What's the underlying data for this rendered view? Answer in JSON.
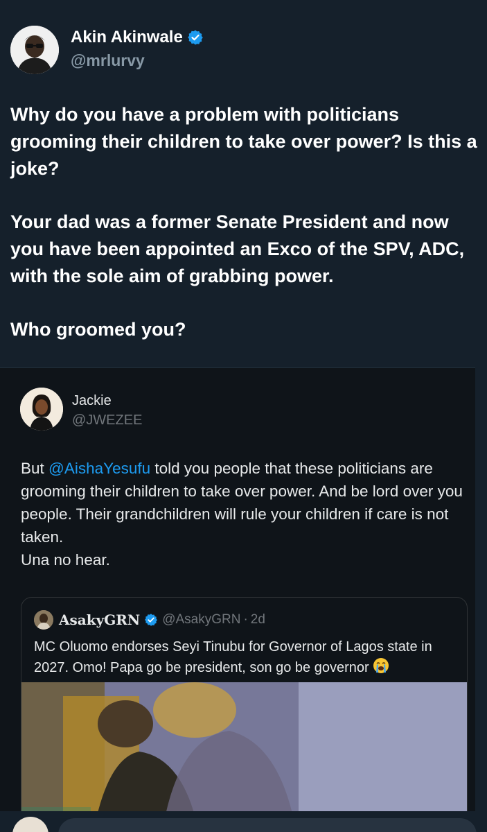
{
  "main_tweet": {
    "author_name": "Akin Akinwale",
    "author_handle": "@mrlurvy",
    "verified": true,
    "paragraphs": [
      "Why do you have a problem with politicians grooming their children to take over power? Is this a joke?",
      "Your dad was a former Senate President and now you have been appointed an Exco of the SPV, ADC, with the sole aim of grabbing power.",
      "Who groomed you?"
    ]
  },
  "quoted_tweet": {
    "author_name": "Jackie",
    "author_handle": "@JWEZEE",
    "text_before_mention": "But ",
    "mention": "@AishaYesufu",
    "text_after_mention": " told you people that these politicians are grooming their children to take over power. And be lord over you people. Their grandchildren will rule your children if care is not taken.",
    "text_line_last": "Una no hear."
  },
  "nested_quote": {
    "author_name": "AsakyGRN",
    "author_handle": "@AsakyGRN",
    "separator": "·",
    "time": "2d",
    "verified": true,
    "text": "MC Oluomo endorses Seyi Tinubu for Governor of Lagos state in 2027. Omo! Papa go be president, son go be governor",
    "emoji": "loudly-crying-face",
    "media": "video-thumbnail"
  },
  "colors": {
    "background": "#15202b",
    "card_background": "#0f1419",
    "text_primary": "#ffffff",
    "text_secondary": "#8899a6",
    "link": "#1d9bf0",
    "verified": "#1d9bf0"
  }
}
